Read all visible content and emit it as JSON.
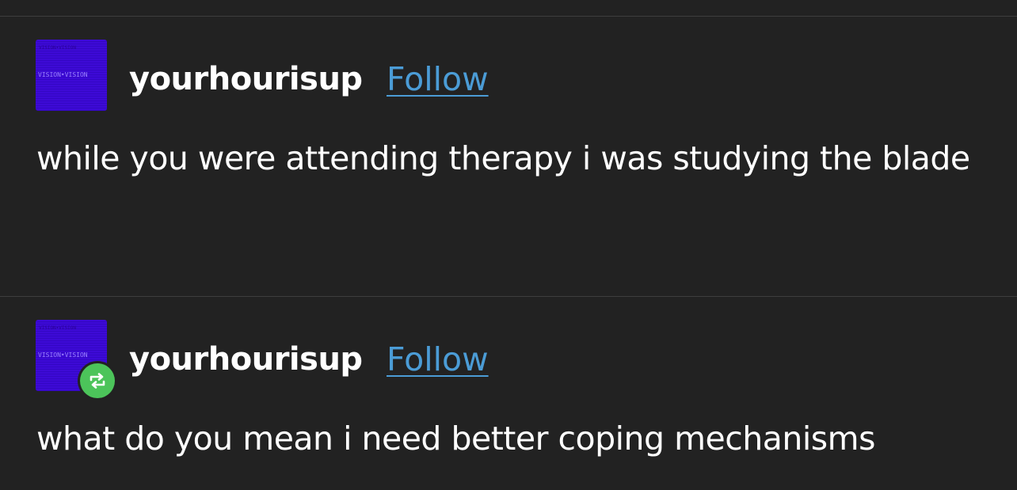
{
  "posts": [
    {
      "username": "yourhourisup",
      "follow_label": "Follow",
      "avatar_text_top": "VISION•VISION",
      "avatar_text": "VISION•VISION",
      "text": "while you were attending therapy i was studying the blade",
      "reblog": false
    },
    {
      "username": "yourhourisup",
      "follow_label": "Follow",
      "avatar_text_top": "VISION•VISION",
      "avatar_text": "VISION•VISION",
      "text": "what do you mean i need better coping mechanisms",
      "reblog": true,
      "reblog_icon": "reblog-icon",
      "reblog_color": "#4cc45a"
    }
  ],
  "colors": {
    "background": "#222222",
    "divider": "#3e3e3e",
    "link": "#4b9cd6",
    "avatar": "#3d0ad6"
  }
}
